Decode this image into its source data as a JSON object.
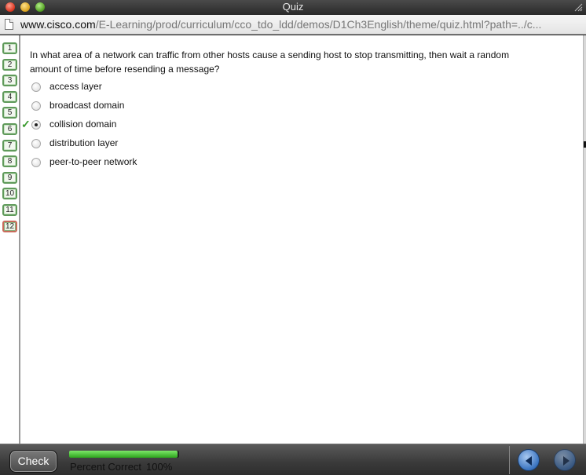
{
  "window": {
    "title": "Quiz"
  },
  "address": {
    "host": "www.cisco.com",
    "path": "/E-Learning/prod/curriculum/cco_tdo_ldd/demos/D1Ch3English/theme/quiz.html?path=../c..."
  },
  "sidebar": {
    "questions": [
      "1",
      "2",
      "3",
      "4",
      "5",
      "6",
      "7",
      "8",
      "9",
      "10",
      "11",
      "12"
    ],
    "current": 12
  },
  "question": {
    "text": "In what area of a network can traffic from other hosts cause a sending host to stop transmitting, then wait a random amount of time before resending a message?",
    "options": [
      {
        "label": "access layer",
        "selected": false,
        "correct": false
      },
      {
        "label": "broadcast domain",
        "selected": false,
        "correct": false
      },
      {
        "label": "collision domain",
        "selected": true,
        "correct": true
      },
      {
        "label": "distribution layer",
        "selected": false,
        "correct": false
      },
      {
        "label": "peer-to-peer network",
        "selected": false,
        "correct": false
      }
    ]
  },
  "footer": {
    "check_label": "Check",
    "percent_label": "Percent Correct",
    "percent_value": "100%",
    "progress_fraction": 1.0,
    "icons": {
      "back": "back-arrow-icon",
      "forward": "forward-arrow-icon"
    }
  },
  "colors": {
    "progress": "#2ca41c",
    "nav": "#3a74c0",
    "correct_check": "#3a9a2e"
  }
}
